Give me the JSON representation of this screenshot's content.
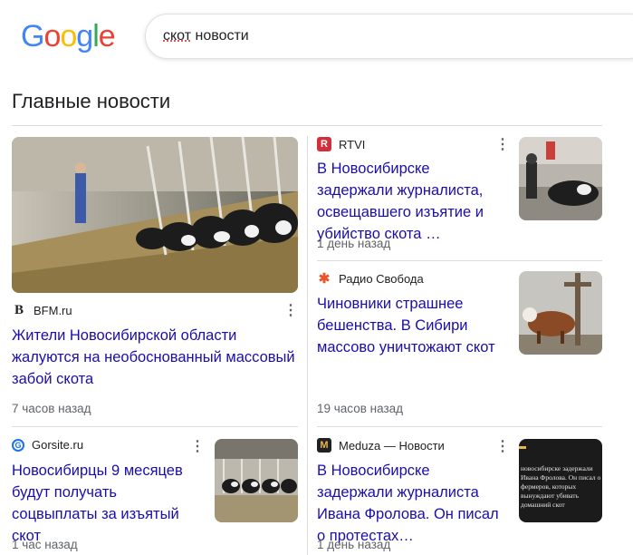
{
  "header": {
    "logo_letters": [
      "G",
      "o",
      "o",
      "g",
      "l",
      "e"
    ],
    "logo_colors": [
      "#4285f4",
      "#ea4335",
      "#fbbc05",
      "#4285f4",
      "#34a853",
      "#ea4335"
    ],
    "search_value_misspelled": "скот",
    "search_value_rest": " новости"
  },
  "section": {
    "title": "Главные новости"
  },
  "articles": [
    {
      "source": "BFM.ru",
      "source_icon": "B",
      "headline": "Жители Новосибирской области жалуются на необоснованный массовый забой скота",
      "time": "7 часов назад"
    },
    {
      "source": "RTVI",
      "source_icon": "R",
      "headline": "В Новосибирске задержали журналиста, освещавшего изъятие и убийство скота …",
      "time": "1 день назад"
    },
    {
      "source": "Радио Свобода",
      "source_icon": "✱",
      "headline": "Чиновники страшнее бешенства. В Сибири массово уничтожают скот",
      "time": "19 часов назад"
    },
    {
      "source": "Gorsite.ru",
      "source_icon": "G",
      "headline": "Новосибирцы 9 месяцев будут получать соцвыплаты за изъятый скот",
      "time": "1 час назад"
    },
    {
      "source": "Meduza — Новости",
      "source_icon": "M",
      "headline": "В Новосибирске задержали журналиста Ивана Фролова. Он писал о протестах…",
      "time": "1 день назад",
      "thumb_text": "новосибирске задержали Ивана Фролова. Он писал о фермеров, которых вынуждают убивать домашний скот"
    }
  ],
  "colors": {
    "link": "#1a0dab",
    "meta": "#5f6368",
    "divider": "#dadce0"
  }
}
